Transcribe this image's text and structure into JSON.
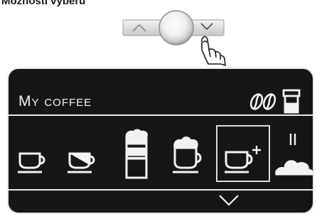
{
  "caption": "Možnosti výběru",
  "screen": {
    "title": "My coffee"
  },
  "selector": {
    "up_icon": "chevron-up-icon",
    "down_icon": "chevron-down-icon",
    "knob_icon": "rotary-knob-icon",
    "pointer_icon": "pointing-finger-icon"
  },
  "header_icons": [
    "coffee-beans-icon",
    "milk-container-icon"
  ],
  "drinks": [
    {
      "icon": "espresso-cup-icon",
      "selected": false
    },
    {
      "icon": "macchiato-cup-icon",
      "selected": false
    },
    {
      "icon": "latte-macchiato-glass-icon",
      "selected": false
    },
    {
      "icon": "cappuccino-cup-icon",
      "selected": false
    },
    {
      "icon": "add-cup-icon",
      "selected": true
    },
    {
      "icon": "milk-foam-icon",
      "selected": false
    }
  ],
  "colors": {
    "panel_background": "#161616",
    "foreground": "#f2f2f2"
  }
}
